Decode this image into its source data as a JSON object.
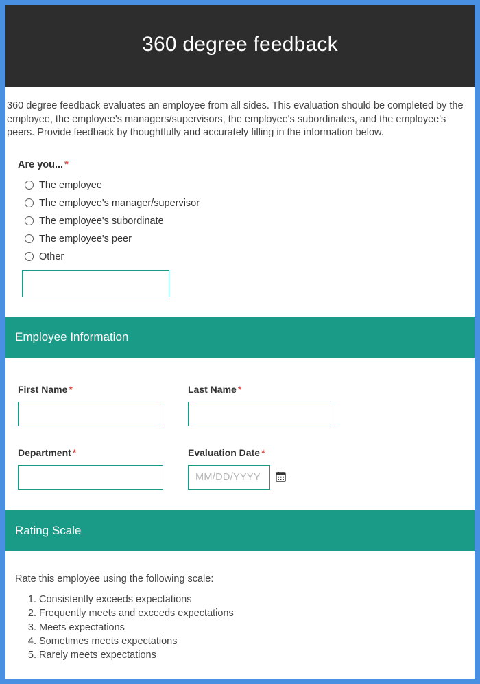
{
  "header": {
    "title": "360 degree feedback"
  },
  "intro": "360 degree feedback evaluates an employee from all sides. This evaluation should be completed by the employee, the employee's managers/supervisors, the employee's subordinates, and the employee's peers. Provide feedback by thoughtfully and accurately filling in the information below.",
  "role_question": {
    "label": "Are you...",
    "options": [
      "The employee",
      "The employee's manager/supervisor",
      "The employee's subordinate",
      "The employee's peer",
      "Other"
    ],
    "other_value": ""
  },
  "emp_section": {
    "heading": "Employee Information",
    "first_name": {
      "label": "First Name",
      "value": ""
    },
    "last_name": {
      "label": "Last Name",
      "value": ""
    },
    "department": {
      "label": "Department",
      "value": ""
    },
    "eval_date": {
      "label": "Evaluation Date",
      "placeholder": "MM/DD/YYYY",
      "value": ""
    }
  },
  "rating_section": {
    "heading": "Rating Scale",
    "intro": "Rate this employee using the following scale:",
    "scale": [
      "Consistently exceeds expectations",
      "Frequently meets and exceeds expectations",
      "Meets expectations",
      "Sometimes meets expectations",
      "Rarely meets expectations"
    ]
  }
}
